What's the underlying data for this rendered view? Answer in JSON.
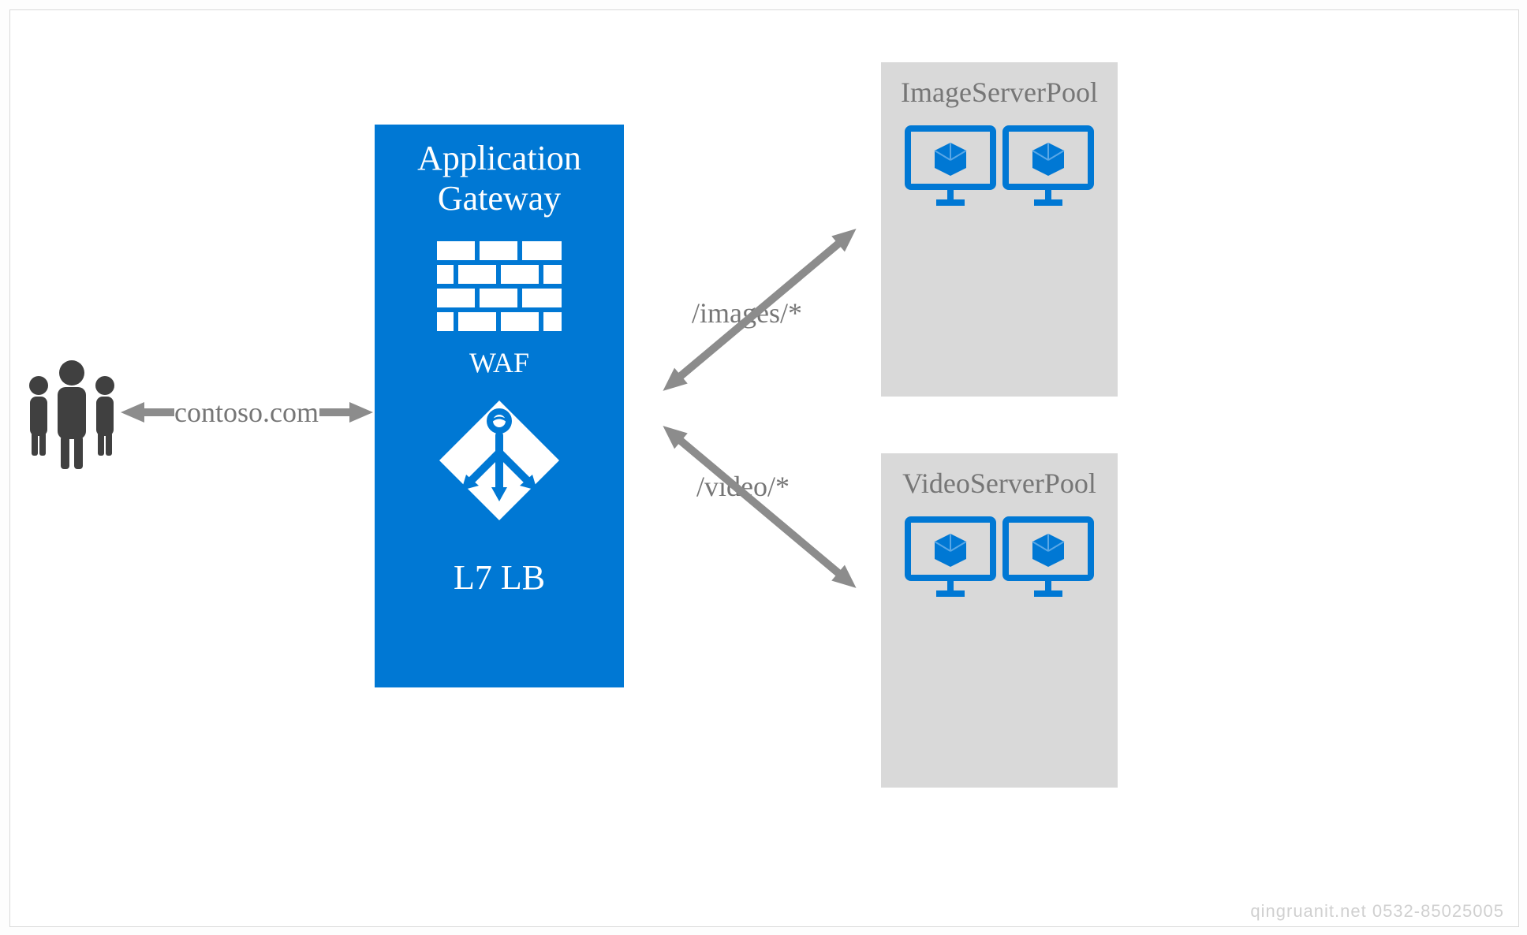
{
  "diagram": {
    "domain_label": "contoso.com",
    "gateway": {
      "title_line1": "Application",
      "title_line2": "Gateway",
      "waf_label": "WAF",
      "lb_label": "L7 LB"
    },
    "routes": {
      "images": "/images/*",
      "video": "/video/*"
    },
    "pools": {
      "image_pool": "ImageServerPool",
      "video_pool": "VideoServerPool"
    },
    "watermark": "qingruanit.net 0532-85025005",
    "colors": {
      "azure_blue": "#0078D4",
      "grey_text": "#767676",
      "grey_box": "#d9d9d9",
      "arrow_grey": "#808080",
      "user_grey": "#404040"
    }
  }
}
